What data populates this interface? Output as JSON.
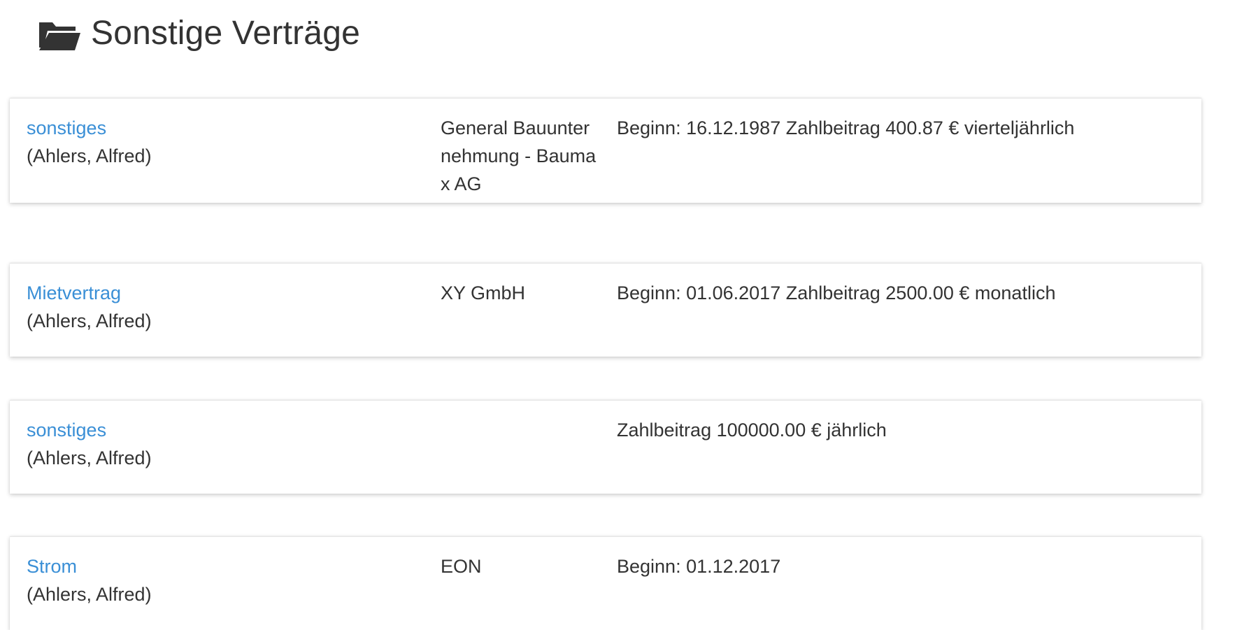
{
  "header": {
    "icon": "folder-open-icon",
    "title": "Sonstige Verträge"
  },
  "colors": {
    "link": "#3a8fd6",
    "text": "#333333",
    "icon": "#333333"
  },
  "contracts": [
    {
      "type_label": "sonstiges",
      "holder": "(Ahlers, Alfred)",
      "provider": "General Bauunternehmung - Baumax AG",
      "details": "Beginn: 16.12.1987 Zahlbeitrag 400.87 € vierteljährlich"
    },
    {
      "type_label": "Mietvertrag",
      "holder": "(Ahlers, Alfred)",
      "provider": "XY GmbH",
      "details": "Beginn: 01.06.2017 Zahlbeitrag 2500.00 € monatlich"
    },
    {
      "type_label": "sonstiges",
      "holder": "(Ahlers, Alfred)",
      "provider": "",
      "details": "Zahlbeitrag 100000.00 € jährlich"
    },
    {
      "type_label": "Strom",
      "holder": "(Ahlers, Alfred)",
      "provider": "EON",
      "details": "Beginn: 01.12.2017"
    }
  ]
}
